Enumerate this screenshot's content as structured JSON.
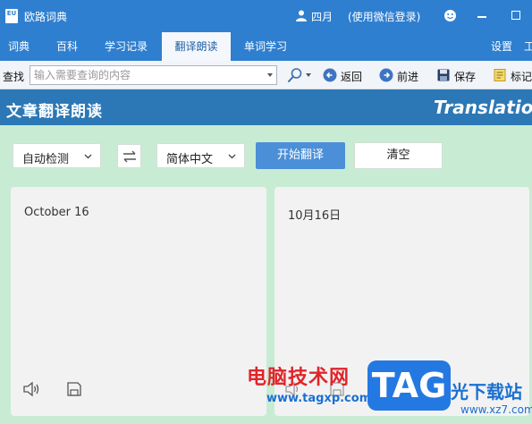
{
  "window": {
    "app_title": "欧路词典",
    "logo_text": "EU",
    "user_name": "四月",
    "login_hint": "(使用微信登录)"
  },
  "tabs": [
    {
      "label": "词典"
    },
    {
      "label": "百科"
    },
    {
      "label": "学习记录"
    },
    {
      "label": "翻译朗读",
      "active": true
    },
    {
      "label": "单词学习"
    }
  ],
  "tabs_right": [
    {
      "label": "设置"
    },
    {
      "label": "工"
    }
  ],
  "toolbar": {
    "search_label": "查找",
    "search_placeholder": "输入需要查询的内容",
    "back_label": "返回",
    "forward_label": "前进",
    "save_label": "保存",
    "mark_label": "标记"
  },
  "banner": {
    "title": "文章翻译朗读",
    "subtitle": "Translatio"
  },
  "controls": {
    "source_lang": "自动检测",
    "target_lang": "简体中文",
    "translate_label": "开始翻译",
    "clear_label": "清空"
  },
  "panels": {
    "source_text": "October 16",
    "target_text": "10月16日"
  },
  "watermark": {
    "cn": "电脑技术网",
    "url": "www.tagxp.com",
    "tag": "TAG",
    "site": "光下载站",
    "site_url": "www.xz7.com"
  },
  "colors": {
    "titlebar": "#2f7fd0",
    "banner": "#2c78b6",
    "page_bg": "#c8ecd3",
    "primary_button": "#4a8fd8"
  }
}
